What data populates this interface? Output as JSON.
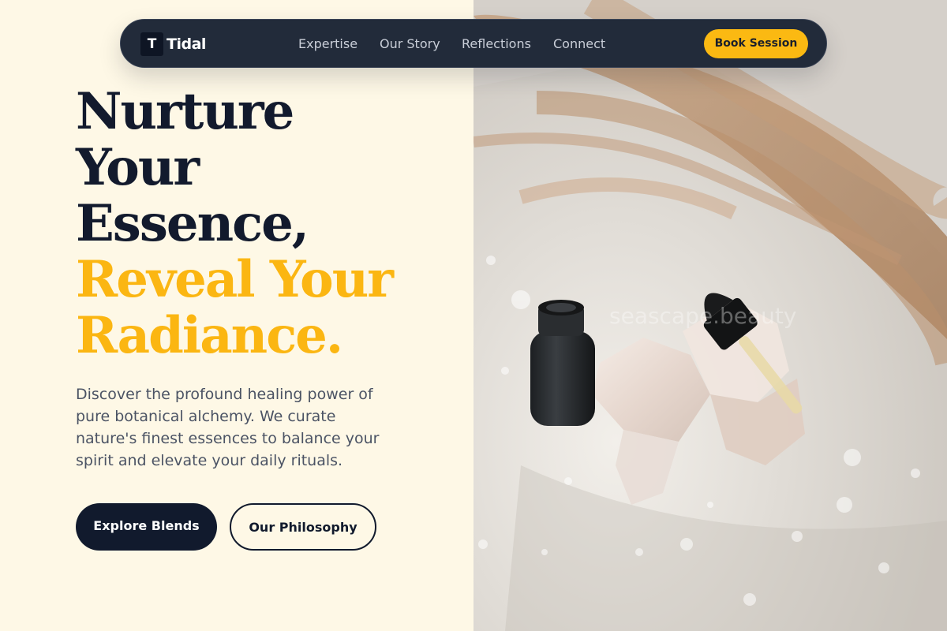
{
  "brand": {
    "logo_letter": "T",
    "name": "Tidal"
  },
  "nav": {
    "links": [
      "Expertise",
      "Our Story",
      "Reflections",
      "Connect"
    ],
    "cta": "Book Session"
  },
  "hero": {
    "heading_dark": [
      "Nurture",
      "Your",
      "Essence,"
    ],
    "heading_accent": [
      "Reveal Your",
      "Radiance."
    ],
    "description": "Discover the profound healing power of pure botanical alchemy. We curate nature's finest essences to balance your spirit and elevate your daily rituals.",
    "primary_button": "Explore Blends",
    "secondary_button": "Our Philosophy"
  },
  "image": {
    "watermark": "seascape.beauty"
  },
  "colors": {
    "accent": "#fbb612",
    "navy": "#111a2d",
    "background": "#fef8e6",
    "nav_background": "#222b3a"
  }
}
